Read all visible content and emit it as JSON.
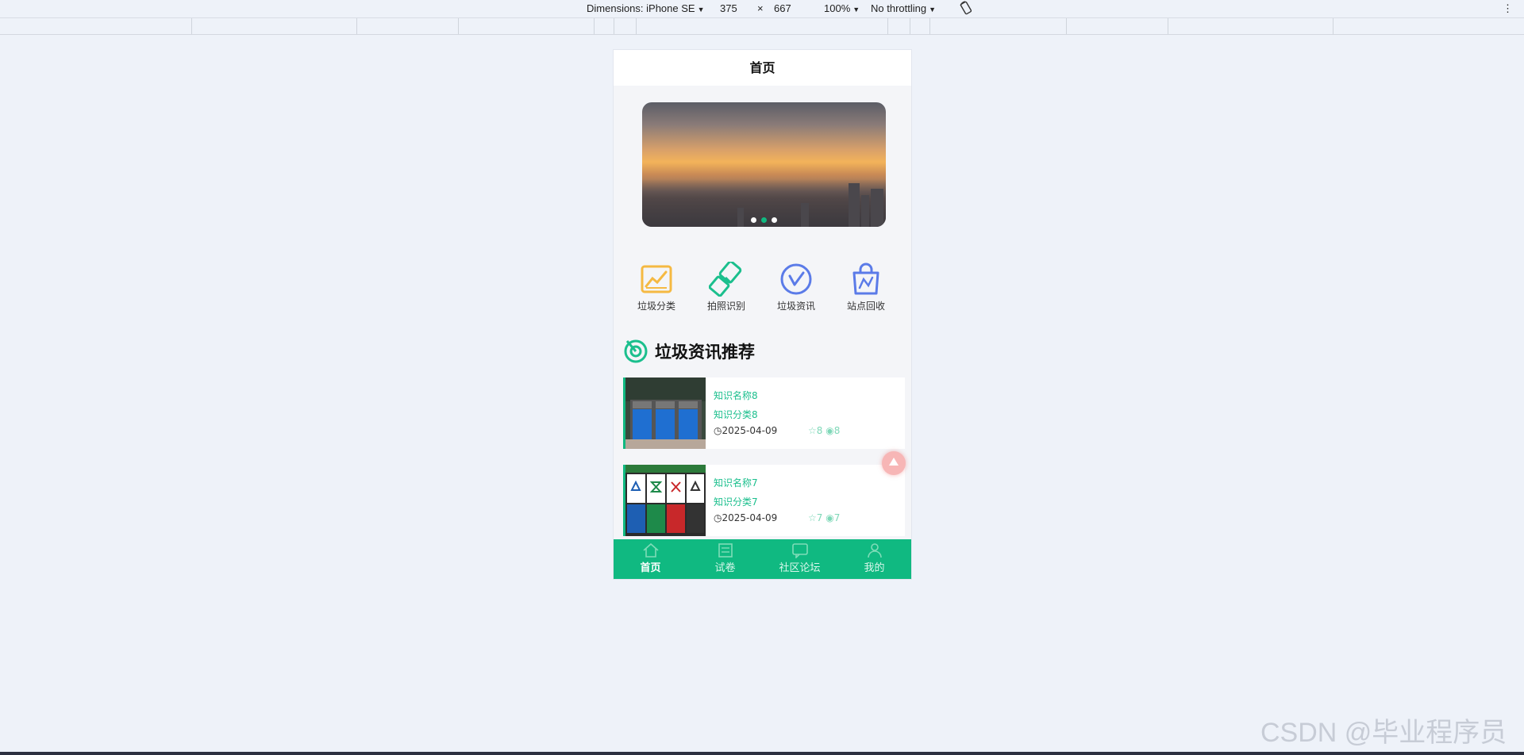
{
  "devtools": {
    "device": "Dimensions: iPhone SE",
    "width": "375",
    "times": "×",
    "height": "667",
    "zoom": "100%",
    "throttle": "No throttling",
    "rotate_icon": "rotate-icon",
    "more_icon": "more-vertical-icon"
  },
  "page": {
    "title": "首页"
  },
  "banner": {
    "slide_count": 3,
    "active_index": 1
  },
  "categories": [
    {
      "label": "垃圾分类",
      "icon": "chart-icon",
      "color": "#f5b942"
    },
    {
      "label": "拍照识别",
      "icon": "brush-icon",
      "color": "#1bbf8d"
    },
    {
      "label": "垃圾资讯",
      "icon": "clock-check-icon",
      "color": "#5b7be8"
    },
    {
      "label": "站点回收",
      "icon": "bag-icon",
      "color": "#5b7be8"
    }
  ],
  "section": {
    "title": "垃圾资讯推荐",
    "icon": "target-icon"
  },
  "articles": [
    {
      "name": "知识名称8",
      "category": "知识分类8",
      "date": "2025-04-09",
      "likes": "8",
      "views": "8"
    },
    {
      "name": "知识名称7",
      "category": "知识分类7",
      "date": "2025-04-09",
      "likes": "7",
      "views": "7"
    }
  ],
  "tabbar": [
    {
      "label": "首页",
      "icon": "home-icon",
      "active": true
    },
    {
      "label": "试卷",
      "icon": "paper-icon",
      "active": false
    },
    {
      "label": "社区论坛",
      "icon": "forum-icon",
      "active": false
    },
    {
      "label": "我的",
      "icon": "user-icon",
      "active": false
    }
  ],
  "colors": {
    "accent": "#10b981",
    "accent_text": "#1bbf8d"
  },
  "watermark": "CSDN @毕业程序员"
}
